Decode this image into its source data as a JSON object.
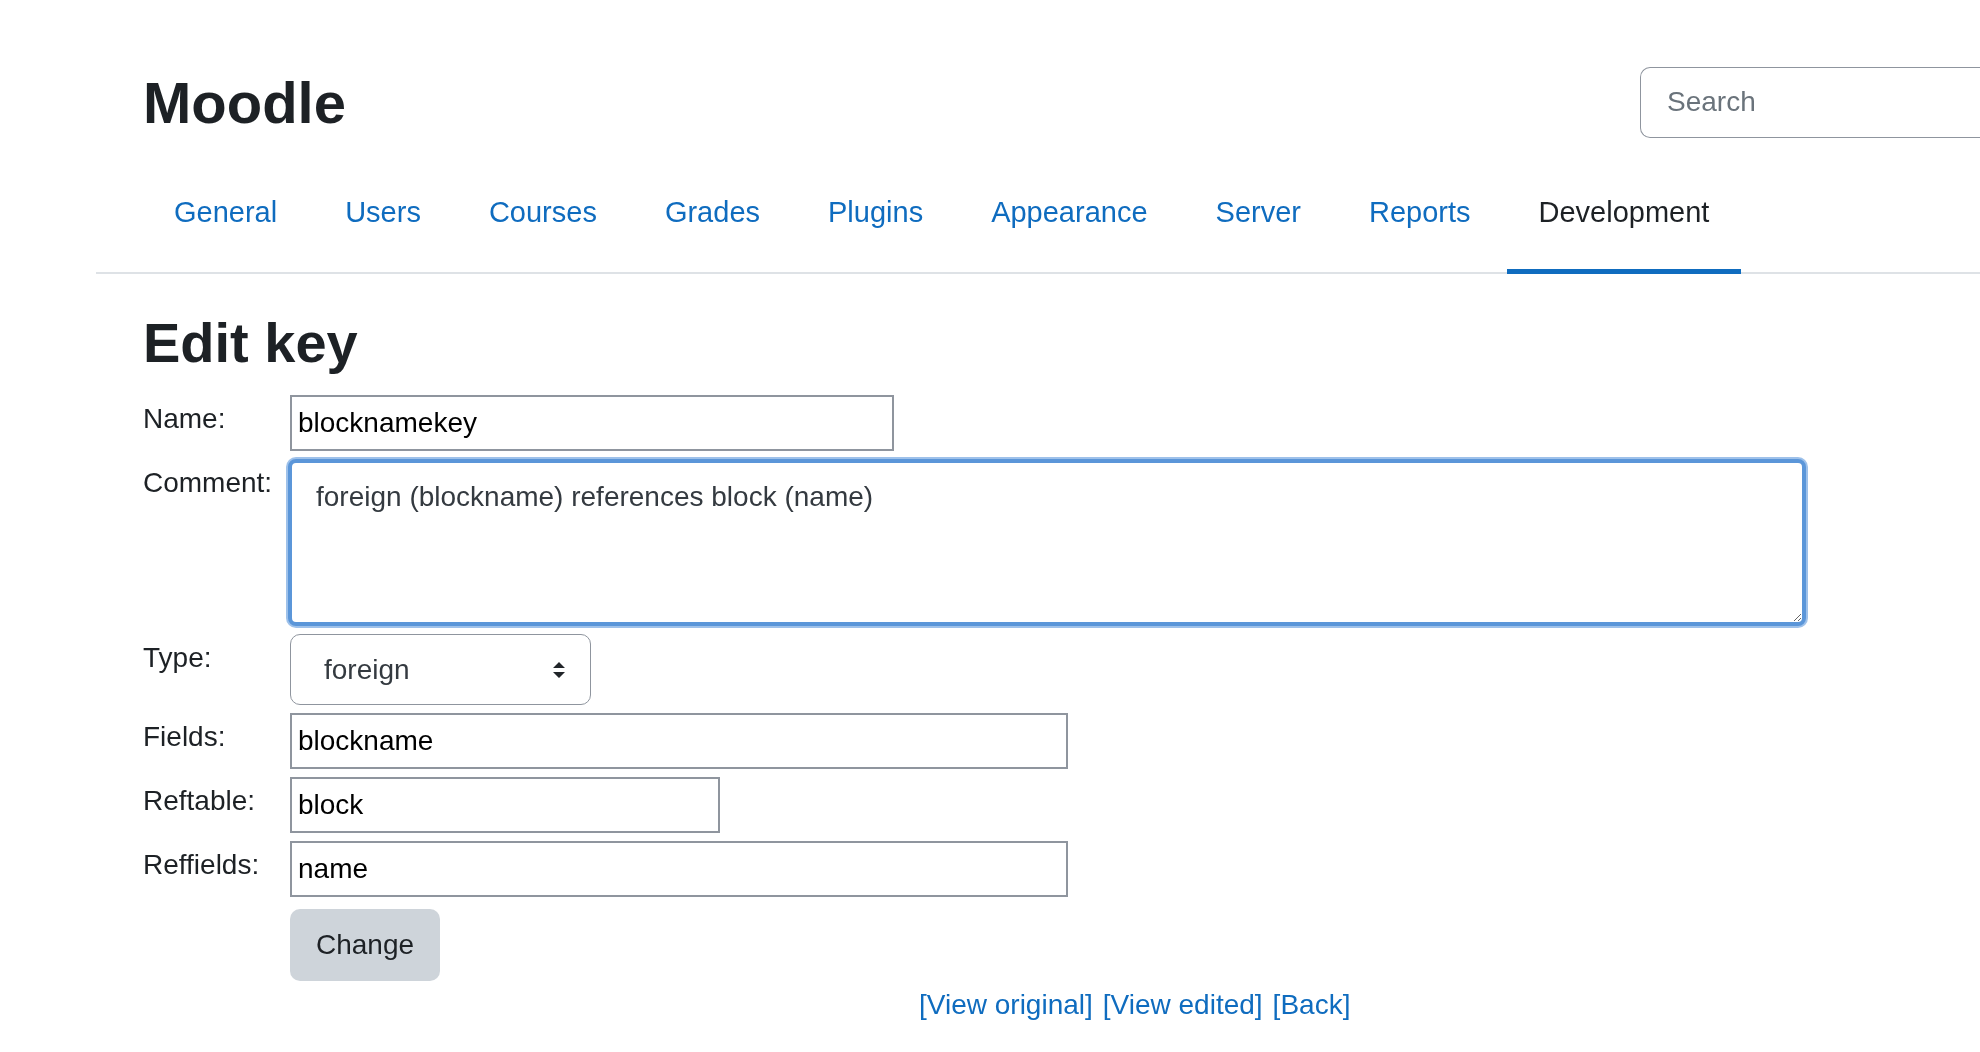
{
  "site": {
    "title": "Moodle",
    "search": {
      "placeholder": "Search"
    }
  },
  "tabs": [
    {
      "label": "General",
      "selected": false
    },
    {
      "label": "Users",
      "selected": false
    },
    {
      "label": "Courses",
      "selected": false
    },
    {
      "label": "Grades",
      "selected": false
    },
    {
      "label": "Plugins",
      "selected": false
    },
    {
      "label": "Appearance",
      "selected": false
    },
    {
      "label": "Server",
      "selected": false
    },
    {
      "label": "Reports",
      "selected": false
    },
    {
      "label": "Development",
      "selected": true
    }
  ],
  "heading": "Edit key",
  "form": [
    {
      "kind": "input",
      "label": "Name:",
      "value": "blocknamekey"
    },
    {
      "kind": "textarea",
      "label": "Comment:",
      "value": "foreign (blockname) references block (name)",
      "focused": true
    },
    {
      "kind": "select",
      "label": "Type:",
      "value": "foreign"
    },
    {
      "kind": "input",
      "label": "Fields:",
      "value": "blockname"
    },
    {
      "kind": "input",
      "label": "Reftable:",
      "value": "block"
    },
    {
      "kind": "input",
      "label": "Reffields:",
      "value": "name"
    }
  ],
  "submit": "Change",
  "links": [
    "[View original]",
    "[View edited]",
    "[Back]"
  ]
}
